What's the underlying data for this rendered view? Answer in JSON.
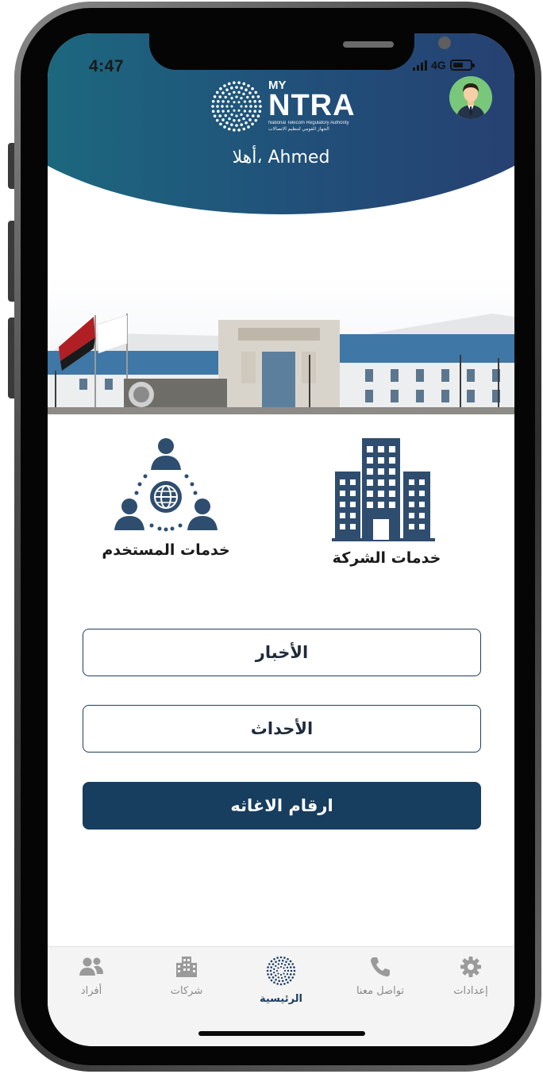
{
  "status_bar": {
    "time": "4:47",
    "network": "4G",
    "signal_icon": "signal-bars-icon",
    "battery_icon": "battery-icon"
  },
  "header": {
    "logo_top": "MY",
    "logo_main": "NTRA",
    "logo_sub_en": "National Telecom Regulatory Authority",
    "logo_sub_ar": "الجهاز القومي لتنظيم الاتصالات",
    "greeting": "أهلا، Ahmed",
    "avatar_icon": "user-avatar-icon"
  },
  "services": [
    {
      "label": "خدمات المستخدم",
      "icon": "users-network-icon"
    },
    {
      "label": "خدمات الشركة",
      "icon": "building-icon"
    }
  ],
  "buttons": {
    "news": "الأخبار",
    "events": "الأحداث",
    "emergency": "ارقام الاغاثه"
  },
  "tabbar": [
    {
      "label": "إعدادات",
      "icon": "gear-icon"
    },
    {
      "label": "تواصل معنا",
      "icon": "phone-icon"
    },
    {
      "label": "الرئيسية",
      "icon": "ntra-logo-icon",
      "active": true
    },
    {
      "label": "شركات",
      "icon": "building-icon"
    },
    {
      "label": "أفراد",
      "icon": "people-icon"
    }
  ],
  "colors": {
    "header_gradient_start": "#1b6e80",
    "header_gradient_end": "#283c70",
    "primary_navy": "#173d5f",
    "icon_navy": "#2f4d6e",
    "active_tab": "#1d3f63",
    "inactive_tab": "#8a8a8a"
  }
}
